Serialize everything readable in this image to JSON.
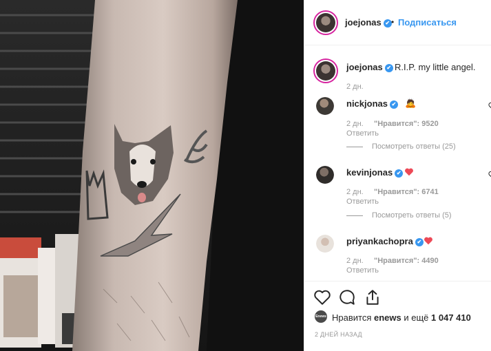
{
  "post": {
    "author": "joejonas",
    "follow_label": "Подписаться",
    "caption": "R.I.P. my little angel.",
    "caption_age": "2 дн."
  },
  "comments": [
    {
      "user": "nickjonas",
      "emoji": "🙇",
      "age": "2 дн.",
      "likes_label": "\"Нравится\":",
      "likes": "9520",
      "reply": "Ответить",
      "view_replies": "Посмотреть ответы (25)"
    },
    {
      "user": "kevinjonas",
      "emoji": "❤️",
      "age": "2 дн.",
      "likes_label": "\"Нравится\":",
      "likes": "6741",
      "reply": "Ответить",
      "view_replies": "Посмотреть ответы (5)"
    },
    {
      "user": "priyankachopra",
      "emoji": "❤️",
      "age": "2 дн.",
      "likes_label": "\"Нравится\":",
      "likes": "4490",
      "reply": "Ответить"
    }
  ],
  "likes": {
    "prefix": "Нравится",
    "user": "enews",
    "middle": "и ещё",
    "count": "1 047 410",
    "avatar_text": "Enews"
  },
  "timestamp": "2 ДНЕЙ НАЗАД",
  "icons": {
    "verified": "verified-badge-icon",
    "like": "heart-icon",
    "comment": "comment-icon",
    "share": "share-icon",
    "comment_like": "heart-outline-icon"
  },
  "colors": {
    "accent": "#3897f0",
    "heart": "#ed4956",
    "muted": "#999999"
  }
}
